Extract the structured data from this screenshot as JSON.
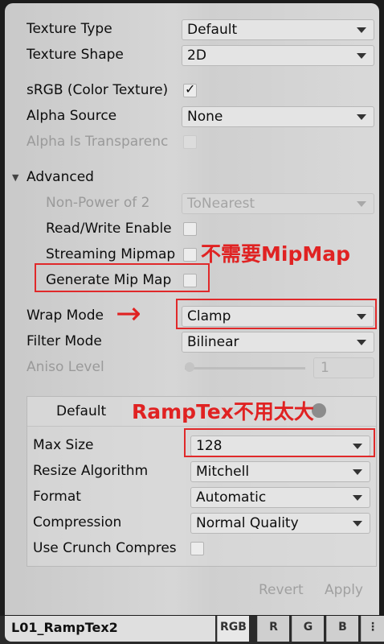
{
  "texture_type": {
    "label": "Texture Type",
    "value": "Default"
  },
  "texture_shape": {
    "label": "Texture Shape",
    "value": "2D"
  },
  "srgb": {
    "label": "sRGB (Color Texture)",
    "checked": true,
    "check_glyph": "✓"
  },
  "alpha_source": {
    "label": "Alpha Source",
    "value": "None"
  },
  "alpha_is_transparency": {
    "label": "Alpha Is Transparenc"
  },
  "advanced": {
    "label": "Advanced",
    "arrow": "▼"
  },
  "non_power_of_2": {
    "label": "Non-Power of 2",
    "value": "ToNearest"
  },
  "read_write": {
    "label": "Read/Write Enable"
  },
  "streaming_mipmaps": {
    "label": "Streaming Mipmap"
  },
  "generate_mip_map": {
    "label": "Generate Mip Map"
  },
  "wrap_mode": {
    "label": "Wrap Mode",
    "value": "Clamp"
  },
  "filter_mode": {
    "label": "Filter Mode",
    "value": "Bilinear"
  },
  "aniso_level": {
    "label": "Aniso Level",
    "value": "1"
  },
  "platform": {
    "tab_label": "Default",
    "max_size": {
      "label": "Max Size",
      "value": "128"
    },
    "resize_algorithm": {
      "label": "Resize Algorithm",
      "value": "Mitchell"
    },
    "format": {
      "label": "Format",
      "value": "Automatic"
    },
    "compression": {
      "label": "Compression",
      "value": "Normal Quality"
    },
    "use_crunch": {
      "label": "Use Crunch Compres"
    }
  },
  "buttons": {
    "revert": "Revert",
    "apply": "Apply"
  },
  "annotations": {
    "no_mipmap": "不需要MipMap",
    "ramptex_size": "RampTex不用太大",
    "arrow_glyph": "→",
    "color": "#e02222"
  },
  "bottom_bar": {
    "asset_name": "L01_RampTex2",
    "channels": [
      "RGB",
      "R",
      "G",
      "B"
    ],
    "menu_glyph": "⋮"
  }
}
